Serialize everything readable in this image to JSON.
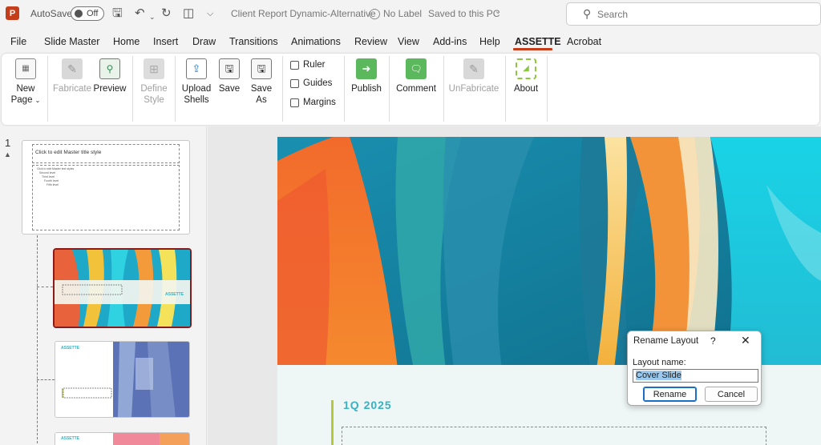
{
  "titlebar": {
    "autosave_label": "AutoSave",
    "autosave_state": "Off",
    "doc_title": "Client Report Dynamic-Alternative",
    "sensitivity_label": "No Label",
    "save_status": "Saved to this PC",
    "search_placeholder": "Search"
  },
  "menu": {
    "tabs": [
      "File",
      "Slide Master",
      "Home",
      "Insert",
      "Draw",
      "Transitions",
      "Animations",
      "Review",
      "View",
      "Add-ins",
      "Help",
      "ASSETTE",
      "Acrobat"
    ],
    "active_tab": "ASSETTE"
  },
  "ribbon": {
    "new_page": [
      "New",
      "Page"
    ],
    "fabricate": "Fabricate",
    "preview": "Preview",
    "define_style": [
      "Define",
      "Style"
    ],
    "upload_shells": [
      "Upload",
      "Shells"
    ],
    "save": "Save",
    "save_as": [
      "Save",
      "As"
    ],
    "ruler": "Ruler",
    "guides": "Guides",
    "margins": "Margins",
    "publish": "Publish",
    "comment": "Comment",
    "unfabricate": "UnFabricate",
    "about": "About"
  },
  "thumbnails": {
    "slide_number": "1",
    "master_title": "Click to edit Master title style",
    "master_body": [
      "Click to edit Master text styles",
      "Second level",
      "Third level",
      "Fourth level",
      "Fifth level"
    ],
    "logo_text": "ASSETTE"
  },
  "slide": {
    "quarter": "1Q 2025"
  },
  "dialog": {
    "title": "Rename Layout",
    "help": "?",
    "close": "✕",
    "field_label": "Layout name:",
    "field_value": "Cover Slide",
    "rename_label": "Rename",
    "cancel_label": "Cancel"
  },
  "colors": {
    "accent": "#c43e1c",
    "teal": "#3ab0c0",
    "olive": "#b7c73a",
    "orange": "#f26a2b"
  }
}
